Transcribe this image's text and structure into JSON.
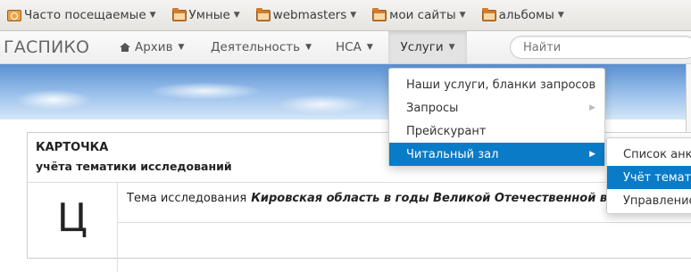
{
  "bookmarks": [
    {
      "label": "Часто посещаемые",
      "icon": "clock-bookmark-icon"
    },
    {
      "label": "Умные",
      "icon": "folder-icon"
    },
    {
      "label": "webmasters",
      "icon": "folder-icon"
    },
    {
      "label": "мои сайты",
      "icon": "folder-icon"
    },
    {
      "label": "альбомы",
      "icon": "folder-icon"
    }
  ],
  "navbar": {
    "brand": "ГАСПИКО",
    "items": [
      {
        "label": "Архив",
        "icon": "home-icon"
      },
      {
        "label": "Деятельность"
      },
      {
        "label": "НСА"
      },
      {
        "label": "Услуги",
        "active": true
      }
    ],
    "search_placeholder": "Найти"
  },
  "services_menu": {
    "items": [
      {
        "label": "Наши услуги, бланки запросов"
      },
      {
        "label": "Запросы",
        "has_submenu": true
      },
      {
        "label": "Прейскурант"
      },
      {
        "label": "Читальный зал",
        "has_submenu": true,
        "highlighted": true
      }
    ]
  },
  "reading_room_submenu": {
    "items": [
      {
        "label": "Список анк"
      },
      {
        "label": "Учёт темати",
        "highlighted": true
      },
      {
        "label": "Управление"
      }
    ]
  },
  "card": {
    "title": "КАРТОЧКА",
    "subtitle": "учёта тематики исследований",
    "letter": "Ц",
    "topic_label": "Тема исследования",
    "topic_value": "Кировская область в годы Великой Отечественной вой"
  },
  "colors": {
    "highlight": "#0a7bc7",
    "folder": "#d07c2c"
  }
}
